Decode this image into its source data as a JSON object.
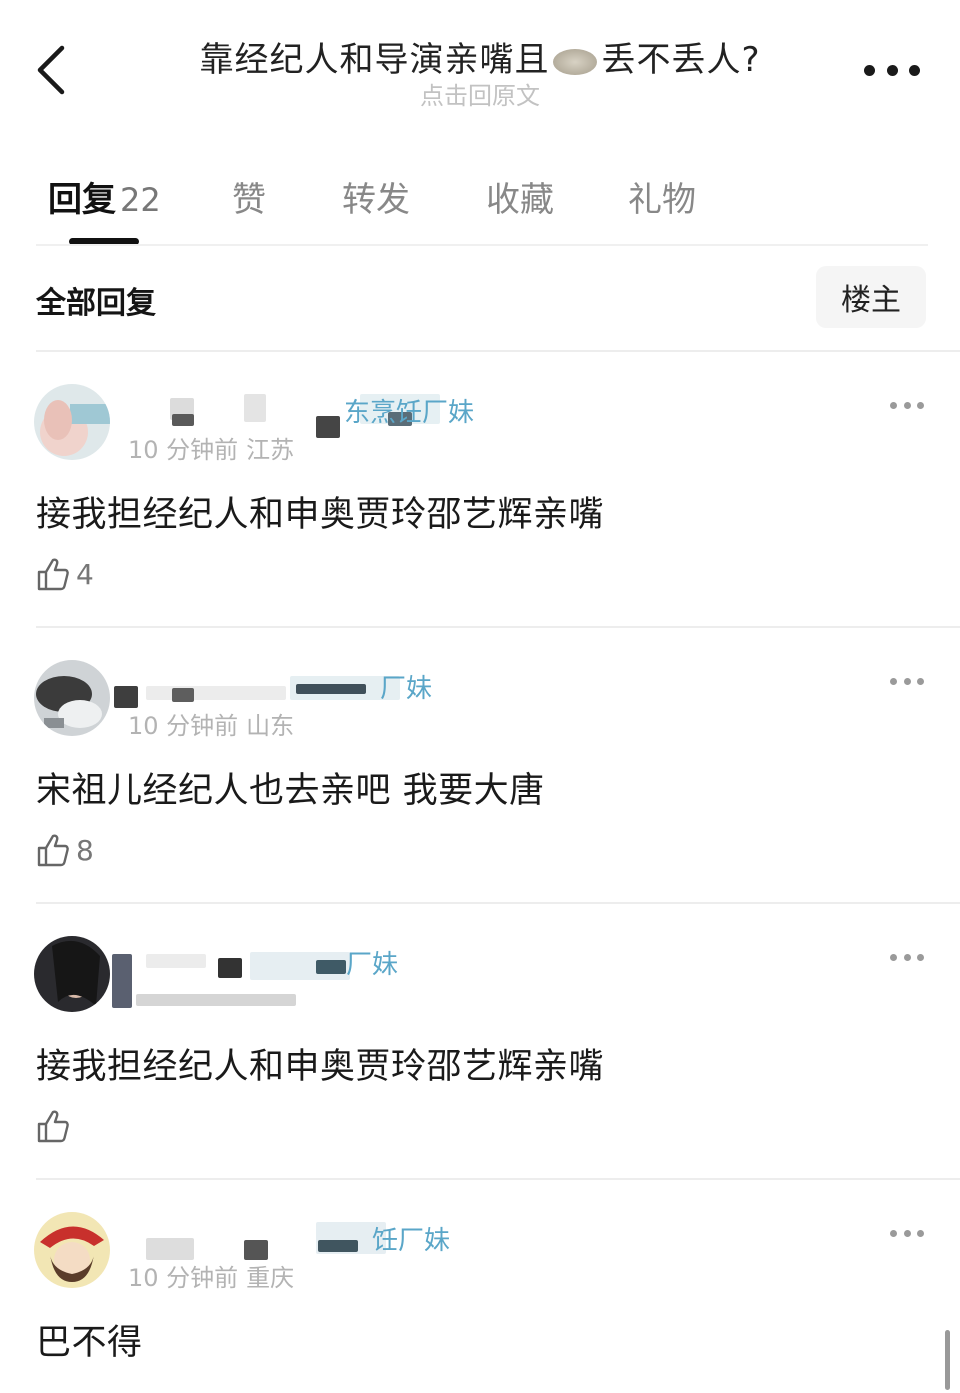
{
  "header": {
    "title_before": "靠经纪人和导演亲嘴且",
    "title_after": "丢不丢人?",
    "subtitle": "点击回原文"
  },
  "tabs": [
    {
      "label": "回复",
      "count": "22",
      "active": true
    },
    {
      "label": "赞"
    },
    {
      "label": "转发"
    },
    {
      "label": "收藏"
    },
    {
      "label": "礼物"
    }
  ],
  "filter": {
    "label": "全部回复",
    "op_button": "楼主"
  },
  "comments": [
    {
      "level_text": "东烹饪厂妹",
      "time": "10 分钟前",
      "location": "江苏",
      "text": "接我担经纪人和申奥贾玲邵艺辉亲嘴",
      "likes": "4"
    },
    {
      "level_text": "厂妹",
      "time": "10 分钟前",
      "location": "山东",
      "text": "宋祖儿经纪人也去亲吧 我要大唐",
      "likes": "8"
    },
    {
      "level_text": "厂妹",
      "time": "",
      "location": "",
      "text": "接我担经纪人和申奥贾玲邵艺辉亲嘴",
      "likes": ""
    },
    {
      "level_text": "饪厂妹",
      "time": "10 分钟前",
      "location": "重庆",
      "text": "巴不得",
      "likes": ""
    }
  ],
  "colors": {
    "level_text": "#5aa6c8",
    "meta_text": "#b3b3b3",
    "tab_inactive": "#888888",
    "tab_active": "#111111"
  }
}
